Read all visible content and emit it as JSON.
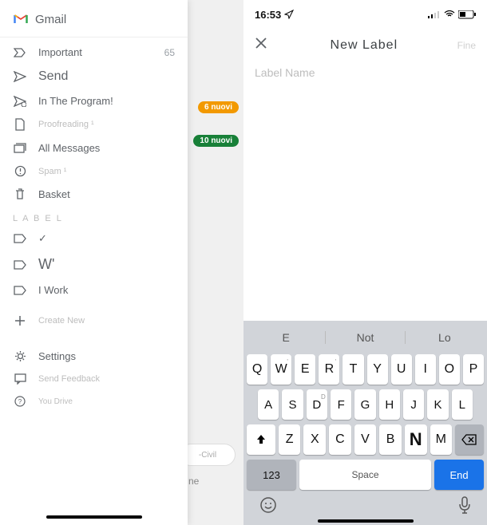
{
  "left": {
    "gmail_title": "Gmail",
    "badges": {
      "orange": "6 nuovi",
      "green": "10 nuovi"
    },
    "pill": "-Civil",
    "one_text": "ne",
    "section_label": "L A B E L",
    "items": {
      "important": {
        "label": "Important",
        "count": "65"
      },
      "send": {
        "label": "Send"
      },
      "inprogram": {
        "label": "In The Program!"
      },
      "proofreading": {
        "label": "Proofreading ¹"
      },
      "allmsg": {
        "label": "All Messages"
      },
      "spam": {
        "label": "Spam ¹"
      },
      "basket": {
        "label": "Basket"
      },
      "label_check": {
        "label": "✓"
      },
      "label_w": {
        "label": "W'"
      },
      "label_work": {
        "label": "I Work"
      },
      "create_new": {
        "label": "Create New"
      },
      "settings": {
        "label": "Settings"
      },
      "feedback": {
        "label": "Send Feedback"
      },
      "drive": {
        "label": "You Drive"
      }
    }
  },
  "right": {
    "status": {
      "time": "16:53"
    },
    "modal_title": "New Label",
    "done_label": "Fine",
    "input_placeholder": "Label Name",
    "suggestions": [
      "E",
      "Not",
      "Lo"
    ],
    "rows": {
      "r1": [
        "Q",
        "W",
        "E",
        "R",
        "T",
        "Y",
        "U",
        "I",
        "O",
        "P"
      ],
      "r1sup": [
        "",
        "'",
        "",
        "'",
        "",
        "",
        "",
        "",
        "",
        ""
      ],
      "r2": [
        "A",
        "S",
        "D",
        "F",
        "G",
        "H",
        "J",
        "K",
        "L"
      ],
      "r2sup": [
        "",
        "",
        "D",
        "",
        "",
        "",
        "",
        "",
        ""
      ],
      "r3": [
        "Z",
        "X",
        "C",
        "V",
        "B",
        "N",
        "M"
      ]
    },
    "sym": "123",
    "space": "Space",
    "enter": "End"
  }
}
